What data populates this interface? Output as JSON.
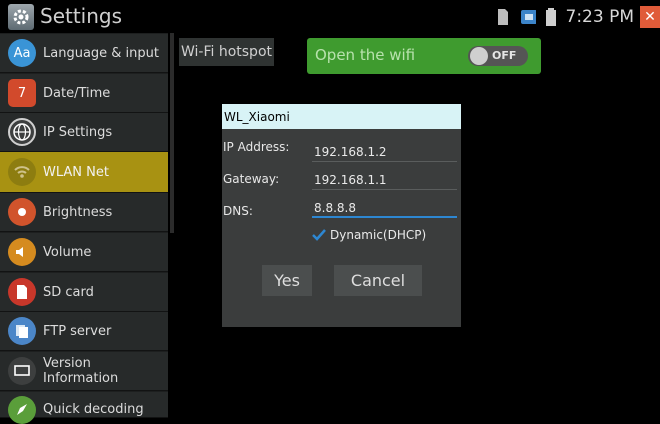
{
  "app": {
    "title": "Settings",
    "icon": "gear-icon"
  },
  "status": {
    "time": "7:23 PM",
    "icons": [
      "sd-card-icon",
      "notification-icon",
      "battery-icon",
      "close-icon"
    ]
  },
  "sidebar": {
    "items": [
      {
        "label": "Language & input",
        "icon": "language-icon",
        "color": "#3a94d6"
      },
      {
        "label": "Date/Time",
        "icon": "calendar-icon",
        "color": "#d24a2c"
      },
      {
        "label": "IP Settings",
        "icon": "globe-icon",
        "color": "#3d3f3f"
      },
      {
        "label": "WLAN Net",
        "icon": "wifi-icon",
        "color": "#8d7d10",
        "active": true
      },
      {
        "label": "Brightness",
        "icon": "brightness-icon",
        "color": "#d1542c"
      },
      {
        "label": "Volume",
        "icon": "speaker-icon",
        "color": "#d58b1f"
      },
      {
        "label": "SD card",
        "icon": "sd-card-icon",
        "color": "#c8372a"
      },
      {
        "label": "FTP server",
        "icon": "ftp-icon",
        "color": "#4b86c8"
      },
      {
        "label": "Version Information",
        "icon": "monitor-icon",
        "color": "#3d3f3f"
      },
      {
        "label": "Quick decoding",
        "icon": "rocket-icon",
        "color": "#5a9e3a"
      }
    ]
  },
  "main": {
    "hotspot_label": "Wi-Fi hotspot",
    "wifi_label": "Open the wifi",
    "toggle_state": "OFF"
  },
  "dialog": {
    "title": "WL_Xiaomi",
    "ip_label": "IP Address:",
    "ip_value": "192.168.1.2",
    "gateway_label": "Gateway:",
    "gateway_value": "192.168.1.1",
    "dns_label": "DNS:",
    "dns_value": "8.8.8.8",
    "dhcp_label": "Dynamic(DHCP)",
    "dhcp_checked": true,
    "yes_label": "Yes",
    "cancel_label": "Cancel"
  },
  "colors": {
    "accent_active": "#a89212",
    "wifi_green": "#3f9b2f",
    "focus_blue": "#2d87d2"
  }
}
